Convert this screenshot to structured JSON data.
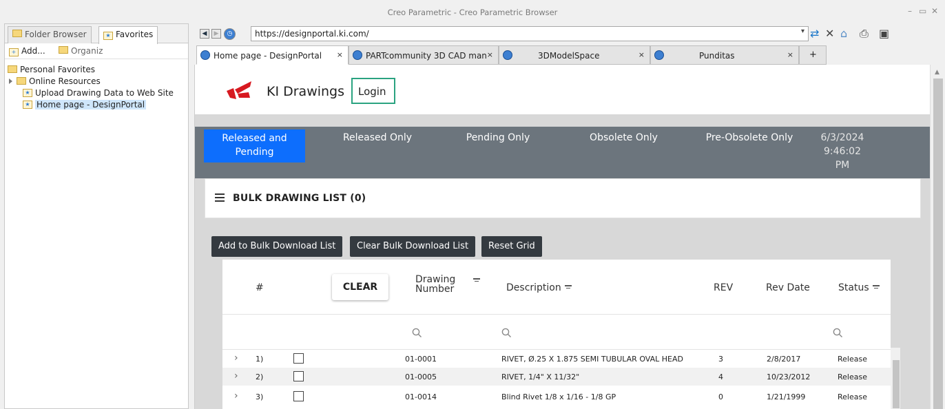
{
  "window": {
    "title": "Creo Parametric - Creo Parametric Browser"
  },
  "left_panel": {
    "tabs": [
      {
        "label": "Folder Browser"
      },
      {
        "label": "Favorites"
      }
    ],
    "toolbar": {
      "add_label": "Add...",
      "organize_label": "Organiz"
    },
    "tree": {
      "root": "Personal Favorites",
      "online_resources": "Online Resources",
      "upload": "Upload Drawing Data to Web Site",
      "home": "Home page - DesignPortal"
    }
  },
  "browser": {
    "url": "https://designportal.ki.com/",
    "tabs": [
      {
        "label": "Home page - DesignPortal"
      },
      {
        "label": "PARTcommunity 3D CAD man"
      },
      {
        "label": "3DModelSpace"
      },
      {
        "label": "Punditas"
      }
    ],
    "close_glyph": "×",
    "new_tab_glyph": "+"
  },
  "site": {
    "name": "KI Drawings",
    "login_label": "Login",
    "filters": [
      {
        "label_line1": "Released and",
        "label_line2": "Pending"
      },
      {
        "label": "Released Only"
      },
      {
        "label": "Pending Only"
      },
      {
        "label": "Obsolete Only"
      },
      {
        "label": "Pre-Obsolete Only"
      }
    ],
    "datetime": {
      "date": "6/3/2024",
      "time": "9:46:02",
      "ampm": "PM"
    },
    "bulk_title": "BULK DRAWING LIST (0)",
    "buttons": {
      "add_bulk": "Add to Bulk Download List",
      "clear_bulk": "Clear Bulk Download List",
      "reset_grid": "Reset Grid"
    },
    "grid": {
      "headers": {
        "num": "#",
        "clear": "CLEAR",
        "drawing_line1": "Drawing",
        "drawing_line2": "Number",
        "description": "Description",
        "rev": "REV",
        "rev_date": "Rev Date",
        "status": "Status"
      },
      "rows": [
        {
          "num": "1)",
          "drawing": "01-0001",
          "description": "RIVET, Ø.25 X 1.875 SEMI TUBULAR OVAL HEAD",
          "rev": "3",
          "date": "2/8/2017",
          "status": "Release"
        },
        {
          "num": "2)",
          "drawing": "01-0005",
          "description": "RIVET, 1/4\" X 11/32\"",
          "rev": "4",
          "date": "10/23/2012",
          "status": "Release"
        },
        {
          "num": "3)",
          "drawing": "01-0014",
          "description": "Blind Rivet 1/8 x 1/16 - 1/8 GP",
          "rev": "0",
          "date": "1/21/1999",
          "status": "Release"
        }
      ]
    }
  },
  "colors": {
    "accent": "#0d6efd",
    "filter_bar": "#6c757d",
    "login_border": "#2aa380",
    "logo_red": "#d71920"
  }
}
